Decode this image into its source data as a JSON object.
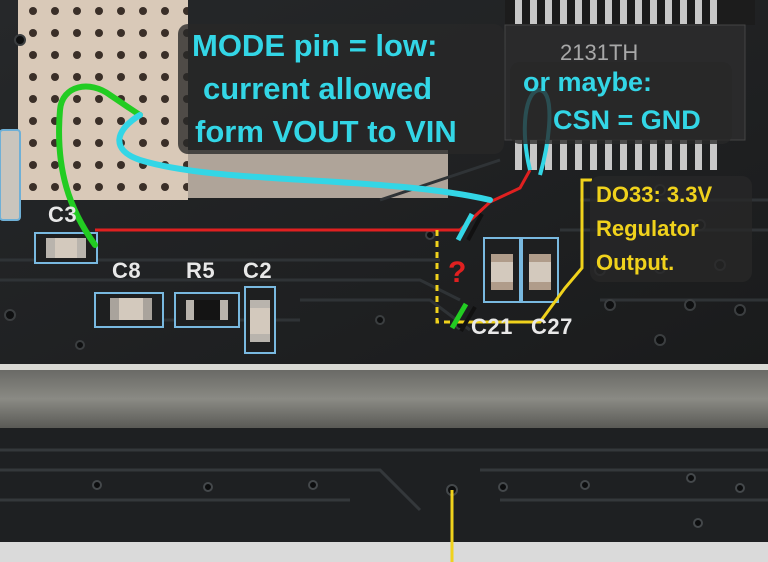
{
  "photo": {
    "subject": "PCB close-up with hand-drawn annotations"
  },
  "annotations": {
    "mode_note": [
      "MODE pin = low:",
      "current allowed",
      "form VOUT to VIN"
    ],
    "csn_note": [
      "or maybe:",
      "CSN = GND"
    ],
    "regulator_note": [
      "DO33: 3.3V",
      "Regulator",
      "Output."
    ],
    "question_mark": "?"
  },
  "silkscreen": {
    "c3": "C3",
    "c8": "C8",
    "r5": "R5",
    "c2": "C2",
    "c21": "C21",
    "c27": "C27",
    "chip_marking": "2131TH"
  },
  "colors": {
    "cyan": "#33d6e6",
    "yellow": "#f0d21c",
    "green": "#22cc22",
    "red": "#e02020"
  }
}
